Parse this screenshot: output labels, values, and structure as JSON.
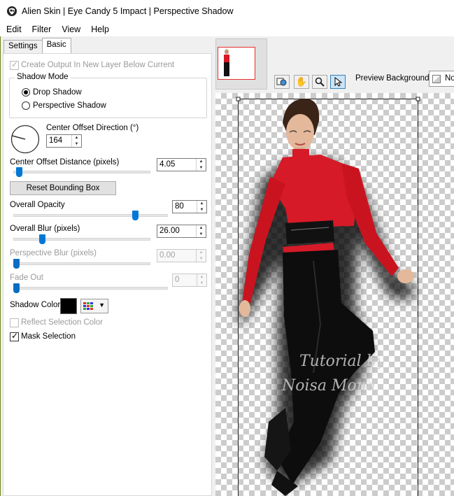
{
  "window": {
    "title": "Alien Skin | Eye Candy 5 Impact | Perspective Shadow"
  },
  "menu": [
    "Edit",
    "Filter",
    "View",
    "Help"
  ],
  "tabs": [
    {
      "label": "Settings",
      "active": false
    },
    {
      "label": "Basic",
      "active": true
    }
  ],
  "basic": {
    "create_output": {
      "label": "Create Output In New Layer Below Current",
      "checked": true,
      "enabled": false
    },
    "shadow_mode": {
      "legend": "Shadow Mode",
      "options": [
        {
          "label": "Drop Shadow",
          "selected": true
        },
        {
          "label": "Perspective Shadow",
          "selected": false
        }
      ]
    },
    "center_offset_direction": {
      "label": "Center Offset Direction (°)",
      "value": "164"
    },
    "center_offset_distance": {
      "label": "Center Offset Distance (pixels)",
      "value": "4.05",
      "fraction": 0.02
    },
    "reset_bounding_box": "Reset Bounding Box",
    "overall_opacity": {
      "label": "Overall Opacity",
      "value": "80",
      "fraction": 0.8
    },
    "overall_blur": {
      "label": "Overall Blur (pixels)",
      "value": "26.00",
      "fraction": 0.2
    },
    "perspective_blur": {
      "label": "Perspective Blur (pixels)",
      "value": "0.00",
      "enabled": false,
      "fraction": 0.0
    },
    "fade_out": {
      "label": "Fade Out",
      "value": "0",
      "enabled": false,
      "fraction": 0.0
    },
    "shadow_color": {
      "label": "Shadow Color",
      "color": "#000000"
    },
    "reflect_selection_color": {
      "label": "Reflect Selection Color",
      "checked": false,
      "enabled": false
    },
    "mask_selection": {
      "label": "Mask Selection",
      "checked": true
    }
  },
  "preview": {
    "background_label": "Preview Background:",
    "background_value": "No",
    "watermark_line1": "Tutorial by",
    "watermark_line2": "Noisa Mona",
    "tools": [
      "preview-navigator-icon",
      "hand-icon",
      "zoom-icon",
      "pointer-icon"
    ]
  },
  "colors": {
    "accent": "#0078d7",
    "top_red": "#d61a27",
    "thumbnail_frame": "#e83030"
  }
}
